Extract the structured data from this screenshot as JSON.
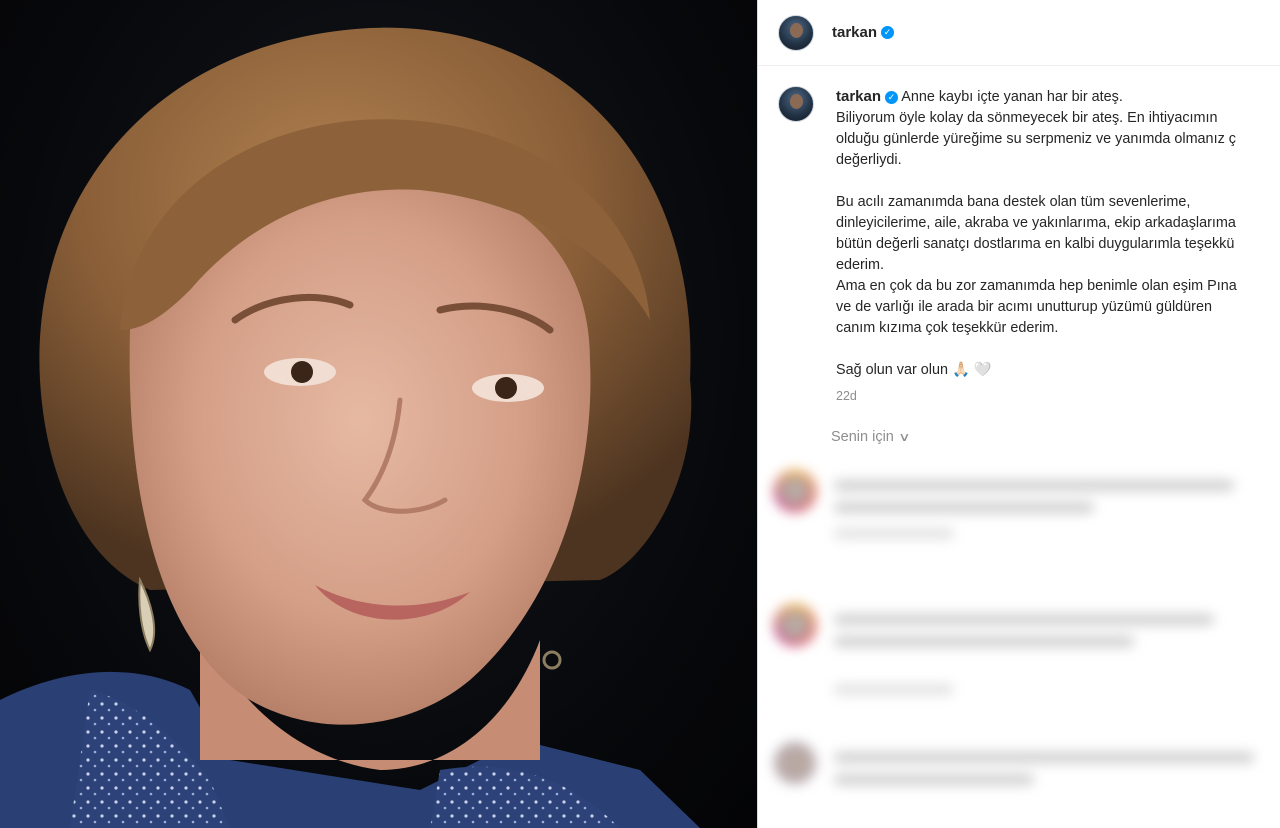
{
  "header": {
    "username": "tarkan",
    "verified_badge": "verified-check-icon"
  },
  "caption": {
    "username": "tarkan",
    "text": "Anne kaybı içte yanan har bir ateş.\nBiliyorum öyle kolay da sönmeyecek bir ateş. En ihtiyacımın\nolduğu günlerde yüreğime su serpmeniz ve yanımda olmanız ç\ndeğerliydi.\n\nBu acılı zamanımda bana destek olan tüm sevenlerime,\ndinleyicilerime, aile, akraba ve yakınlarıma, ekip arkadaşlarıma\nbütün değerli sanatçı dostlarıma en kalbi duygularımla teşekkü\nederim.\nAma en çok da bu zor zamanımda hep benimle olan eşim Pına\nve de varlığı ile arada bir acımı unutturup yüzümü güldüren\ncanım kızıma çok teşekkür ederim.\n\nSağ olun var olun 🙏🏻 🤍",
    "timestamp": "22d"
  },
  "comments_filter": {
    "label": "Senin için",
    "icon": "chevron-down-icon"
  },
  "colors": {
    "verified": "#0095f6",
    "text": "#262626",
    "muted": "#8e8e8e"
  }
}
